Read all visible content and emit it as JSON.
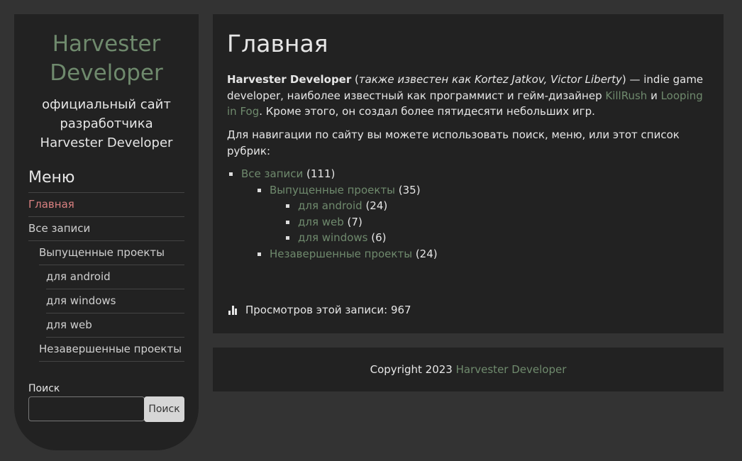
{
  "sidebar": {
    "site_title": "Harvester Developer",
    "site_description": "официальный сайт разработчика Harvester Developer",
    "menu_title": "Меню",
    "menu_items": [
      {
        "label": "Главная",
        "active": true
      },
      {
        "label": "Все записи"
      },
      {
        "label": "Выпущенные проекты"
      },
      {
        "label": "для android"
      },
      {
        "label": "для windows"
      },
      {
        "label": "для web"
      },
      {
        "label": "Незавершенные проекты"
      }
    ],
    "search": {
      "label": "Поиск",
      "value": "",
      "button_label": "Поиск"
    }
  },
  "main": {
    "page_title": "Главная",
    "intro": {
      "name": "Harvester Developer",
      "paren_open": " (",
      "aka": "также известен как Kortez Jatkov, Victor Liberty",
      "after_aka": ") — indie game developer, наиболее известный как программист и гейм-дизайнер ",
      "link1": "KillRush",
      "conj": " и ",
      "link2": "Looping in Fog",
      "tail": ". Кроме этого, он создал более пятидесяти небольших игр."
    },
    "navigation_text": "Для навигации по сайту вы можете использовать поиск, меню, или этот список рубрик:",
    "categories": [
      {
        "label": "Все записи",
        "count": " (111)"
      },
      {
        "label": "Выпущенные проекты",
        "count": " (35)"
      },
      {
        "label": "для android",
        "count": " (24)"
      },
      {
        "label": "для web",
        "count": " (7)"
      },
      {
        "label": "для windows",
        "count": " (6)"
      },
      {
        "label": "Незавершенные проекты",
        "count": " (24)"
      }
    ],
    "views_text": "Просмотров этой записи: 967"
  },
  "footer": {
    "copyright": "Copyright 2023 ",
    "site_link": "Harvester Developer"
  },
  "colors": {
    "background": "#333333",
    "panel": "#222222",
    "link": "#6f8a6d",
    "active_menu": "#d98080"
  }
}
